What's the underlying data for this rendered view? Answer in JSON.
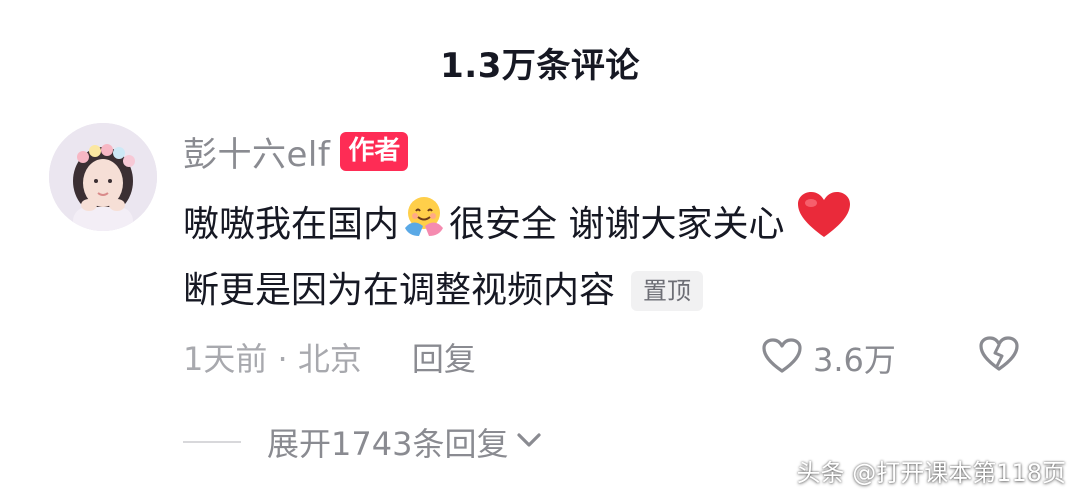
{
  "header": {
    "title": "1.3万条评论"
  },
  "comment": {
    "username": "彭十六elf",
    "author_badge": "作者",
    "line1_part1": "嗷嗷我在国内",
    "line1_part2": "很安全 谢谢大家关心",
    "line2": "断更是因为在调整视频内容",
    "pinned_label": "置顶",
    "time_location": "1天前 · 北京",
    "reply_label": "回复",
    "like_count": "3.6万",
    "emojis": [
      "hug-emoji",
      "red-heart-emoji"
    ]
  },
  "replies": {
    "expand_label": "展开1743条回复"
  },
  "watermark": {
    "text": "头条 @打开课本第118页"
  },
  "colors": {
    "author_badge_bg": "#fe2c55",
    "text_primary": "#161823",
    "text_secondary": "#8a8b91",
    "text_muted": "#a8a9ae",
    "pinned_bg": "#f1f1f2"
  },
  "icons": {
    "like": "heart-outline-icon",
    "dislike": "broken-heart-icon",
    "expand": "chevron-down-icon"
  }
}
